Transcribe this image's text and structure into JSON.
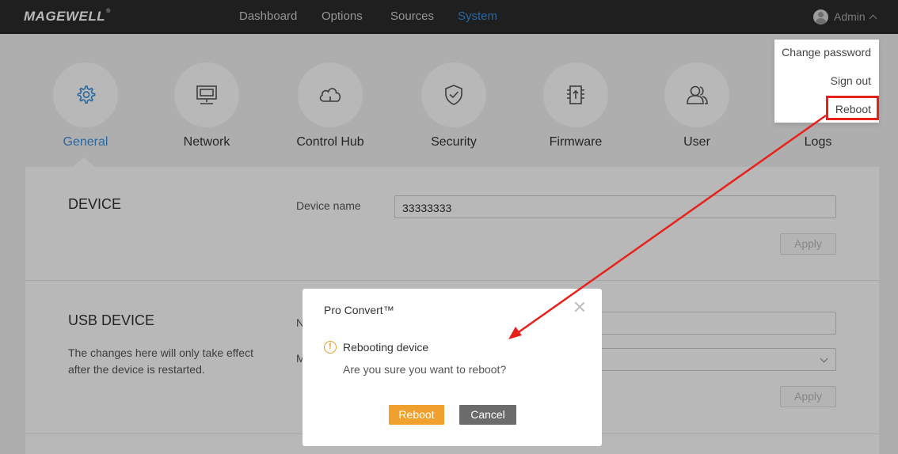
{
  "brand": {
    "logo_text": "MAGEWELL",
    "logo_mark": "®"
  },
  "nav": {
    "items": [
      {
        "label": "Dashboard"
      },
      {
        "label": "Options"
      },
      {
        "label": "Sources"
      },
      {
        "label": "System"
      }
    ],
    "active": "System",
    "user": {
      "label": "Admin"
    }
  },
  "user_menu": {
    "items": [
      {
        "label": "Change password"
      },
      {
        "label": "Sign out"
      },
      {
        "label": "Reboot"
      }
    ]
  },
  "categories": [
    {
      "label": "General",
      "icon": "gear-icon",
      "active": true
    },
    {
      "label": "Network",
      "icon": "monitor-icon"
    },
    {
      "label": "Control Hub",
      "icon": "cloud-icon"
    },
    {
      "label": "Security",
      "icon": "shield-icon"
    },
    {
      "label": "Firmware",
      "icon": "chip-upload-icon"
    },
    {
      "label": "User",
      "icon": "users-icon"
    },
    {
      "label": "Logs",
      "icon": "logs-icon"
    }
  ],
  "device": {
    "title": "DEVICE",
    "name_label": "Device name",
    "name_value": "33333333",
    "apply_label": "Apply"
  },
  "usb_device": {
    "title": "USB DEVICE",
    "description": "The changes here will only take effect after the device is restarted.",
    "field1_label_fragment": "N",
    "field2_label_fragment": "M",
    "apply_label": "Apply"
  },
  "modal": {
    "title": "Pro Convert™",
    "heading": "Rebooting device",
    "message": "Are you sure you want to reboot?",
    "confirm_label": "Reboot",
    "cancel_label": "Cancel",
    "warn_glyph": "!"
  },
  "colors": {
    "accent": "#3a8fe0",
    "topbar": "#2b2b2b",
    "primary_button": "#f0a02c",
    "secondary_button": "#6b6b6b",
    "annotation": "#e8201a"
  }
}
